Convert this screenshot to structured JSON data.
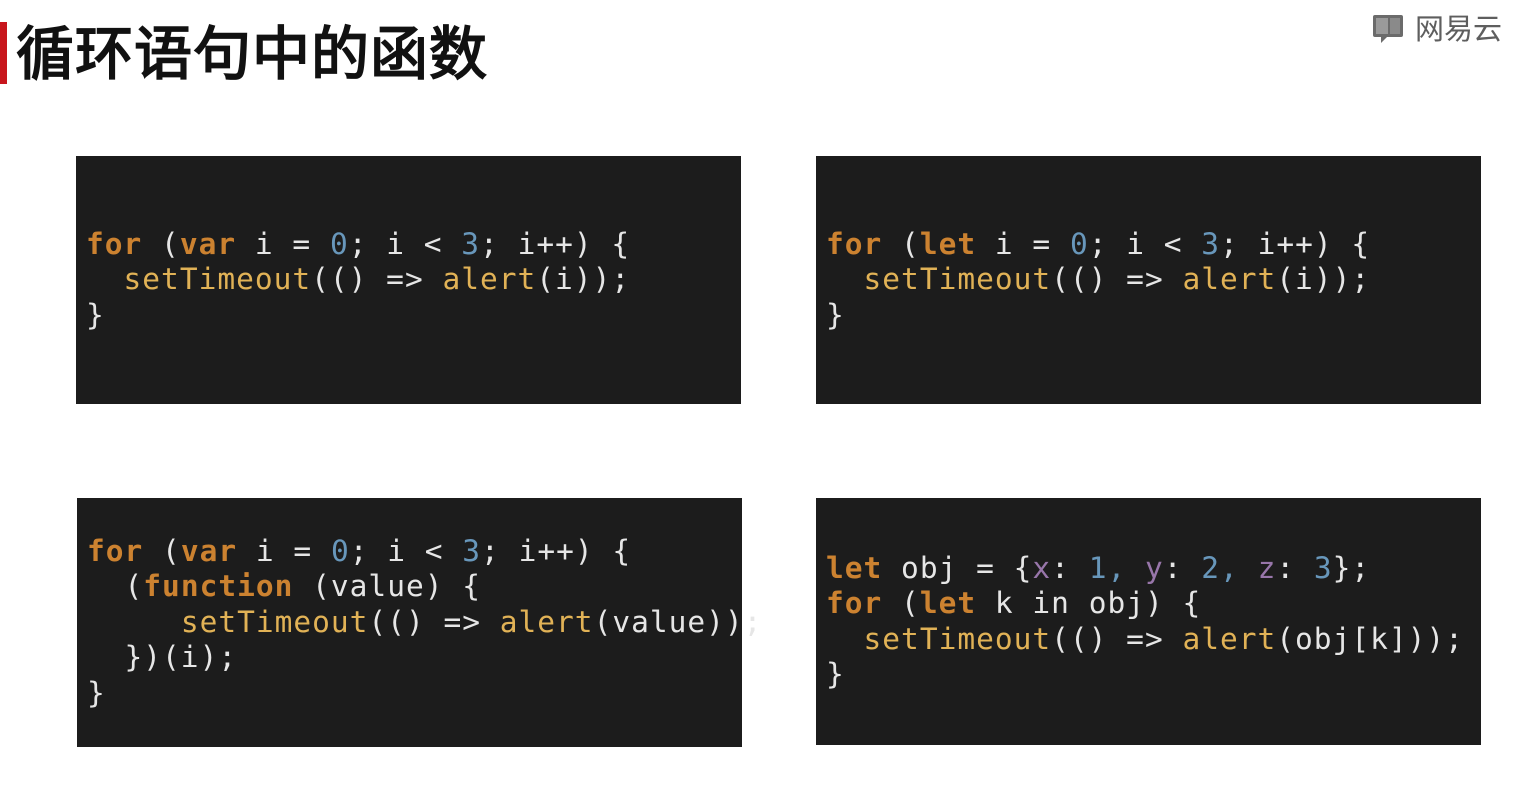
{
  "header": {
    "title": "循环语句中的函数",
    "accent_color": "#c8161d",
    "logo_icon": "book-icon",
    "logo_text": "网易云"
  },
  "code_theme": {
    "background": "#1c1c1c",
    "keyword": "#cc8230",
    "function": "#e1b256",
    "number": "#6897bb",
    "property": "#9876aa",
    "plain": "#e6e6e6"
  },
  "code_blocks": [
    {
      "lines": [
        [
          [
            "k",
            "for"
          ],
          [
            "p",
            " ("
          ],
          [
            "k",
            "var"
          ],
          [
            "p",
            " i = "
          ],
          [
            "n",
            "0"
          ],
          [
            "p",
            "; i < "
          ],
          [
            "n",
            "3"
          ],
          [
            "p",
            "; i++) {"
          ]
        ],
        [
          [
            "p",
            "  "
          ],
          [
            "f",
            "setTimeout"
          ],
          [
            "p",
            "(() => "
          ],
          [
            "f",
            "alert"
          ],
          [
            "p",
            "(i));"
          ]
        ],
        [
          [
            "p",
            "}"
          ]
        ]
      ]
    },
    {
      "lines": [
        [
          [
            "k",
            "for"
          ],
          [
            "p",
            " ("
          ],
          [
            "k",
            "let"
          ],
          [
            "p",
            " i = "
          ],
          [
            "n",
            "0"
          ],
          [
            "p",
            "; i < "
          ],
          [
            "n",
            "3"
          ],
          [
            "p",
            "; i++) {"
          ]
        ],
        [
          [
            "p",
            "  "
          ],
          [
            "f",
            "setTimeout"
          ],
          [
            "p",
            "(() => "
          ],
          [
            "f",
            "alert"
          ],
          [
            "p",
            "(i));"
          ]
        ],
        [
          [
            "p",
            "}"
          ]
        ]
      ]
    },
    {
      "lines": [
        [
          [
            "k",
            "for"
          ],
          [
            "p",
            " ("
          ],
          [
            "k",
            "var"
          ],
          [
            "p",
            " i = "
          ],
          [
            "n",
            "0"
          ],
          [
            "p",
            "; i < "
          ],
          [
            "n",
            "3"
          ],
          [
            "p",
            "; i++) {"
          ]
        ],
        [
          [
            "p",
            "  ("
          ],
          [
            "k",
            "function"
          ],
          [
            "p",
            " (value) {"
          ]
        ],
        [
          [
            "p",
            "     "
          ],
          [
            "f",
            "setTimeout"
          ],
          [
            "p",
            "(() => "
          ],
          [
            "f",
            "alert"
          ],
          [
            "p",
            "(value));"
          ]
        ],
        [
          [
            "p",
            "  })(i);"
          ]
        ],
        [
          [
            "p",
            "}"
          ]
        ]
      ]
    },
    {
      "lines": [
        [
          [
            "k",
            "let"
          ],
          [
            "p",
            " obj = {"
          ],
          [
            "v",
            "x"
          ],
          [
            "p",
            ": "
          ],
          [
            "n",
            "1, "
          ],
          [
            "v",
            "y"
          ],
          [
            "p",
            ": "
          ],
          [
            "n",
            "2, "
          ],
          [
            "v",
            "z"
          ],
          [
            "p",
            ": "
          ],
          [
            "n",
            "3"
          ],
          [
            "p",
            "};"
          ]
        ],
        [
          [
            "k",
            "for"
          ],
          [
            "p",
            " ("
          ],
          [
            "k",
            "let"
          ],
          [
            "p",
            " k in obj) {"
          ]
        ],
        [
          [
            "p",
            "  "
          ],
          [
            "f",
            "setTimeout"
          ],
          [
            "p",
            "(() => "
          ],
          [
            "f",
            "alert"
          ],
          [
            "p",
            "(obj[k]));"
          ]
        ],
        [
          [
            "p",
            "}"
          ]
        ]
      ]
    }
  ]
}
